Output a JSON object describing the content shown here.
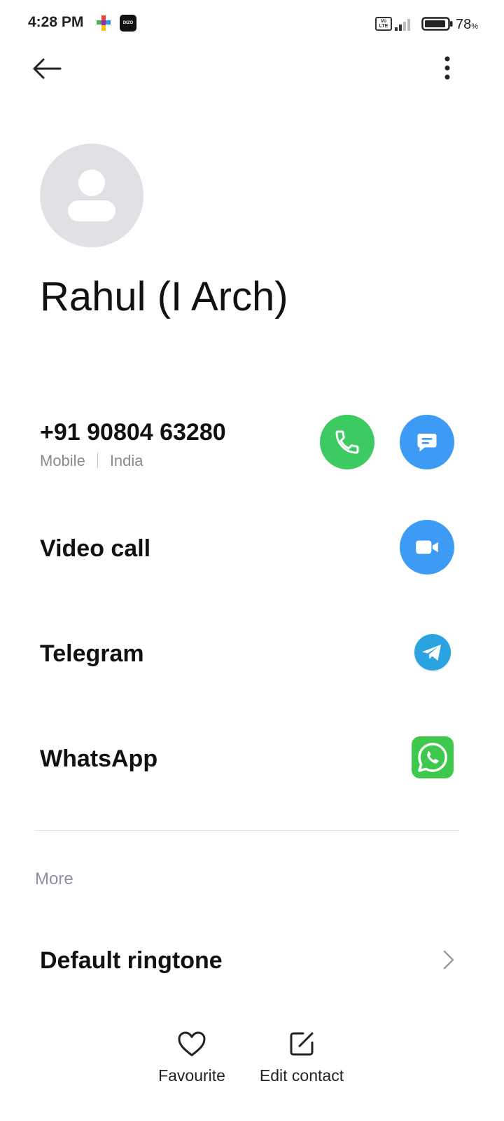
{
  "status_bar": {
    "time": "4:28 PM",
    "app_badge_text": "DIZO",
    "volte": "Vo LTE",
    "battery_percent": "78",
    "battery_unit": "%"
  },
  "contact": {
    "name": "Rahul (I Arch)",
    "phone": "+91 90804 63280",
    "phone_type": "Mobile",
    "phone_region": "India"
  },
  "actions": {
    "video_call": "Video call",
    "telegram": "Telegram",
    "whatsapp": "WhatsApp"
  },
  "section": {
    "more": "More"
  },
  "settings": {
    "default_ringtone": "Default ringtone"
  },
  "bottom_bar": {
    "favourite": "Favourite",
    "edit_contact": "Edit contact"
  },
  "colors": {
    "call_green": "#3dca62",
    "action_blue": "#3d9bf5",
    "telegram_blue": "#2aa3e0",
    "whatsapp_green": "#3ec84c",
    "avatar_grey": "#dfe1e5"
  },
  "icons": {
    "back": "arrow-left-icon",
    "menu": "more-vertical-icon",
    "call": "phone-icon",
    "message": "chat-bubble-icon",
    "video": "video-camera-icon",
    "telegram": "telegram-icon",
    "whatsapp": "whatsapp-icon",
    "favourite": "heart-icon",
    "edit": "edit-icon",
    "chevron": "chevron-right-icon"
  }
}
